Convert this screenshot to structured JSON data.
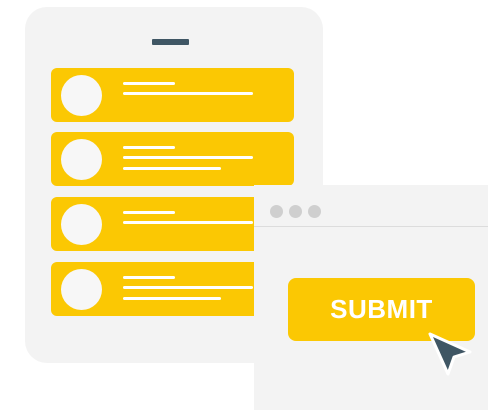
{
  "form_window": {
    "submit_label": "SUBMIT"
  },
  "icons": [
    "speaker-icon",
    "window-control-dot",
    "cursor-arrow-icon"
  ],
  "colors": {
    "accent": "#fbc803",
    "panel": "#f3f3f3",
    "speaker": "#3f5664",
    "cursor": "#3f5664",
    "text_on_accent": "#ffffff"
  }
}
